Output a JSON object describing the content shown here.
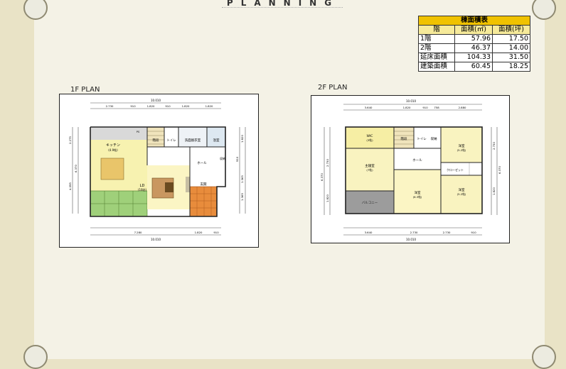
{
  "header": {
    "title": "PLANNING"
  },
  "area_table": {
    "title": "棟面積表",
    "col_floor": "階",
    "col_m2": "面積(㎡)",
    "col_tsubo": "面積(坪)",
    "rows": [
      {
        "label": "1階",
        "m2": "57.96",
        "tsubo": "17.50"
      },
      {
        "label": "2階",
        "m2": "46.37",
        "tsubo": "14.00"
      },
      {
        "label": "延床面積",
        "m2": "104.33",
        "tsubo": "31.50"
      },
      {
        "label": "建築面積",
        "m2": "60.45",
        "tsubo": "18.25"
      }
    ]
  },
  "plan_1f": {
    "label": "1F PLAN",
    "total_width": "10.010",
    "top_dims": [
      "2.730",
      "910",
      "1.820",
      "910",
      "1.820",
      "1.820"
    ],
    "bottom_dims": [
      "7.280",
      "1.820",
      "910"
    ],
    "left_dims": [
      "2.275",
      "6.370",
      "4.095"
    ],
    "right_dims": [
      "1.820",
      "910",
      "1.365",
      "1.365"
    ],
    "rooms": {
      "kitchen": "キッチン",
      "kitchen_size": "(4.9帖)",
      "stairs": "階段",
      "toilet": "トイレ",
      "washroom": "洗面脱衣室",
      "bath": "浴室",
      "hall": "ホール",
      "ldk": "LD",
      "ldk_size": "(16帖)",
      "entrance": "玄関",
      "closet": "収納",
      "pantry": "PS"
    }
  },
  "plan_2f": {
    "label": "2F PLAN",
    "total_width": "10.010",
    "top_dims": [
      "3.640",
      "1.820",
      "910",
      "758",
      "2.880"
    ],
    "bottom_dims": [
      "3.640",
      "2.730",
      "2.730",
      "910"
    ],
    "left_dims": [
      "6.370",
      "2.730",
      "1.820"
    ],
    "right_dims": [
      "2.730",
      "1.820",
      "6.370"
    ],
    "rooms": {
      "wic": "WIC",
      "wic_size": "(3帖)",
      "stairs": "階段",
      "toilet": "トイレ",
      "storage": "収納",
      "hall": "ホール",
      "bedroom_main": "主寝室",
      "bedroom_main_size": "(7帖)",
      "western1": "洋室",
      "western1_size": "(5.2帖)",
      "western2": "洋室",
      "western2_size": "(5.2帖)",
      "closet": "クローゼット",
      "balcony": "バルコニー",
      "room_center": "洋室",
      "room_center_size": "(6.3帖)"
    }
  }
}
